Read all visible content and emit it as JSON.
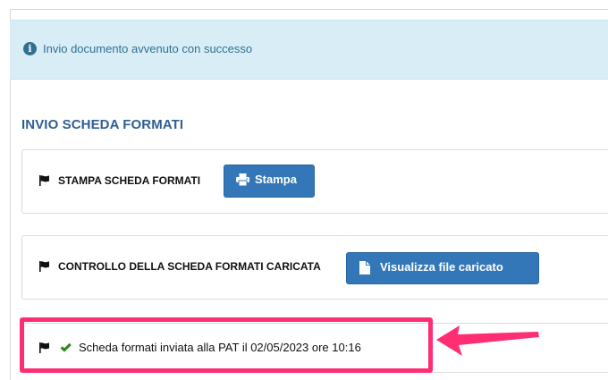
{
  "alert": {
    "icon": "info-circle-icon",
    "text": "Invio documento avvenuto con successo",
    "background": "#d9edf7",
    "color": "#31708f"
  },
  "section": {
    "title": "INVIO SCHEDA FORMATI",
    "title_color": "#2f5e93"
  },
  "panels": [
    {
      "icon": "flag-icon",
      "label": "STAMPA SCHEDA FORMATI",
      "button": {
        "icon": "print-icon",
        "label": "Stampa"
      }
    },
    {
      "icon": "flag-icon",
      "label": "CONTROLLO DELLA SCHEDA FORMATI CARICATA",
      "button": {
        "icon": "file-icon",
        "label": "Visualizza file caricato"
      }
    },
    {
      "icon": "flag-icon",
      "status_icon": "checkmark-icon",
      "status_text": "Scheda formati inviata alla PAT il 02/05/2023 ore 10:16"
    }
  ],
  "colors": {
    "button": "#3477b8",
    "check": "#2e8b1f",
    "annotation": "#ff2e72"
  }
}
